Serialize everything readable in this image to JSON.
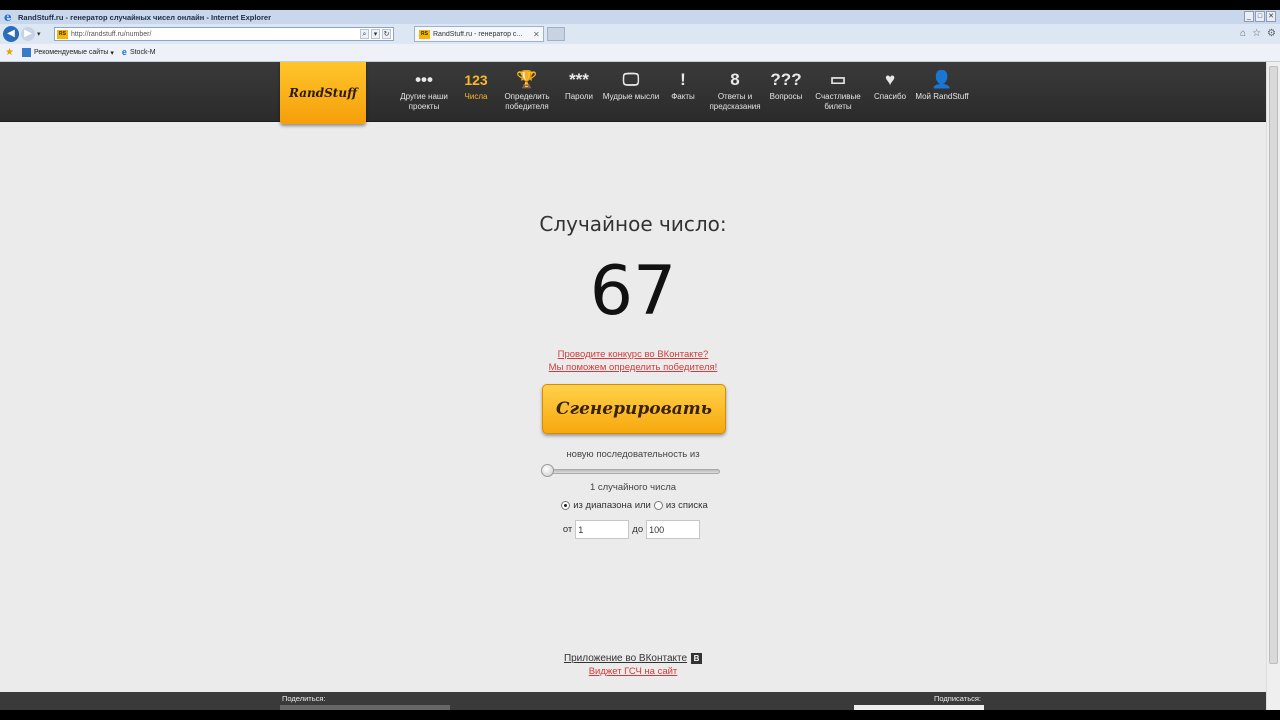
{
  "browser": {
    "window_title": "RandStuff.ru - генератор случайных чисел онлайн - Internet Explorer",
    "url": "http://randstuff.ru/number/",
    "tab_title": "RandStuff.ru - генератор с...",
    "favorites": [
      "Рекомендуемые сайты",
      "Stock-M"
    ]
  },
  "site": {
    "logo": "RandStuff",
    "nav": [
      {
        "icon": "•••",
        "label": "Другие наши проекты",
        "active": false
      },
      {
        "icon": "123",
        "label": "Числа",
        "active": true
      },
      {
        "icon": "🏆",
        "label": "Определить победителя",
        "active": false
      },
      {
        "icon": "***",
        "label": "Пароли",
        "active": false
      },
      {
        "icon": "🖵",
        "label": "Мудрые мысли",
        "active": false
      },
      {
        "icon": "!",
        "label": "Факты",
        "active": false
      },
      {
        "icon": "8",
        "label": "Ответы и предсказания",
        "active": false
      },
      {
        "icon": "???",
        "label": "Вопросы",
        "active": false
      },
      {
        "icon": "▭",
        "label": "Счастливые билеты",
        "active": false
      },
      {
        "icon": "♥",
        "label": "Спасибо",
        "active": false
      },
      {
        "icon": "👤",
        "label": "Мой RandStuff",
        "active": false
      }
    ]
  },
  "main": {
    "title": "Случайное число:",
    "number": "67",
    "link1": "Проводите конкурс во ВКонтакте?",
    "link2": "Мы поможем определить победителя!",
    "generate_button": "Сгенерировать",
    "sequence_label": "новую последовательность из",
    "count_label": "1 случайного числа",
    "mode_range": "из диапазона или",
    "mode_list": "из списка",
    "from_label": "от",
    "from_value": "1",
    "to_label": "до",
    "to_value": "100",
    "vk_app": "Приложение во ВКонтакте",
    "widget": "Виджет ГСЧ на сайт"
  },
  "footer": {
    "share": "Поделиться:",
    "subscribe": "Подписаться:"
  }
}
